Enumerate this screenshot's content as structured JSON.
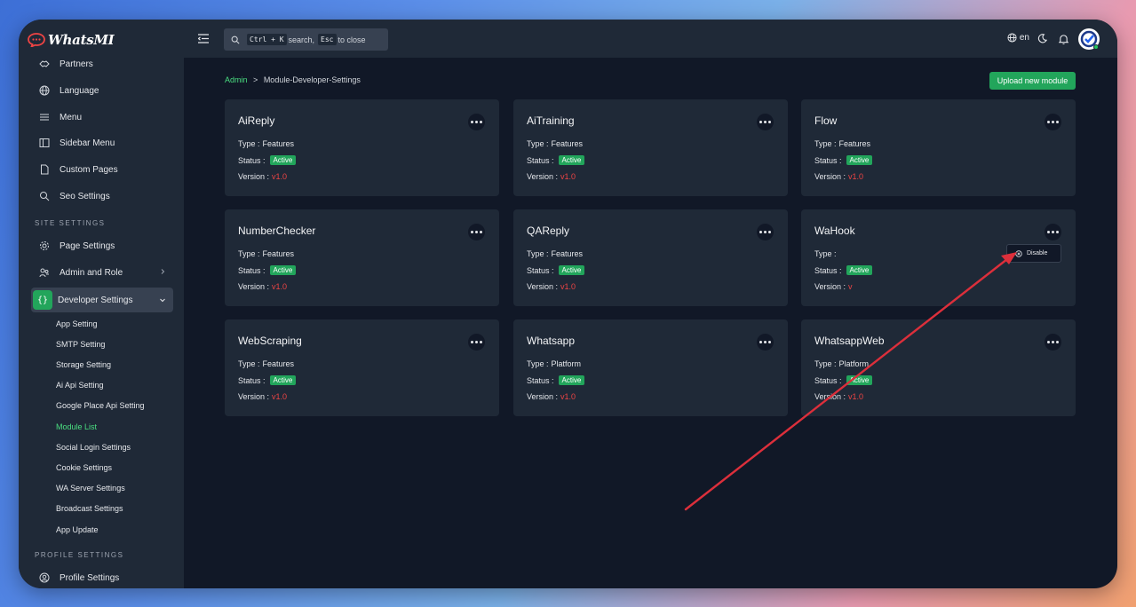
{
  "app": {
    "logo_text": "WhatsMI",
    "brand_color": "#22a55b"
  },
  "sidebar": {
    "top_items": [
      {
        "label": "Partners",
        "icon": "handshake-icon"
      },
      {
        "label": "Language",
        "icon": "globe-icon"
      },
      {
        "label": "Menu",
        "icon": "menu-icon"
      },
      {
        "label": "Sidebar Menu",
        "icon": "sidebar-icon"
      },
      {
        "label": "Custom Pages",
        "icon": "file-icon"
      },
      {
        "label": "Seo Settings",
        "icon": "search-icon"
      }
    ],
    "site_settings_label": "SITE SETTINGS",
    "site_items": [
      {
        "label": "Page Settings",
        "icon": "gear-icon"
      },
      {
        "label": "Admin and Role",
        "icon": "users-icon"
      },
      {
        "label": "Developer Settings",
        "icon": "code-braces-icon"
      }
    ],
    "developer_sub_items": [
      "App Setting",
      "SMTP Setting",
      "Storage Setting",
      "Ai Api Setting",
      "Google Place Api Setting",
      "Module List",
      "Social Login Settings",
      "Cookie Settings",
      "WA Server Settings",
      "Broadcast Settings",
      "App Update"
    ],
    "profile_settings_label": "PROFILE SETTINGS",
    "profile_items": [
      {
        "label": "Profile Settings",
        "icon": "user-circle-icon"
      }
    ]
  },
  "topbar": {
    "search_key1": "Ctrl + K",
    "search_text1": "search,",
    "search_key2": "Esc",
    "search_text2": "to close",
    "language": "en"
  },
  "breadcrumb": {
    "root": "Admin",
    "separator": ">",
    "current": "Module-Developer-Settings"
  },
  "upload_button": "Upload new module",
  "labels": {
    "type": "Type :",
    "status": "Status :",
    "version": "Version :"
  },
  "modules": [
    {
      "name": "AiReply",
      "type": "Features",
      "status": "Active",
      "version": "v1.0"
    },
    {
      "name": "AiTraining",
      "type": "Features",
      "status": "Active",
      "version": "v1.0"
    },
    {
      "name": "Flow",
      "type": "Features",
      "status": "Active",
      "version": "v1.0"
    },
    {
      "name": "NumberChecker",
      "type": "Features",
      "status": "Active",
      "version": "v1.0"
    },
    {
      "name": "QAReply",
      "type": "Features",
      "status": "Active",
      "version": "v1.0"
    },
    {
      "name": "WaHook",
      "type": "",
      "status": "Active",
      "version": "v"
    },
    {
      "name": "WebScraping",
      "type": "Features",
      "status": "Active",
      "version": "v1.0"
    },
    {
      "name": "Whatsapp",
      "type": "Platform",
      "status": "Active",
      "version": "v1.0"
    },
    {
      "name": "WhatsappWeb",
      "type": "Platform",
      "status": "Active",
      "version": "v1.0"
    }
  ],
  "dropdown": {
    "disable_label": "Disable"
  }
}
